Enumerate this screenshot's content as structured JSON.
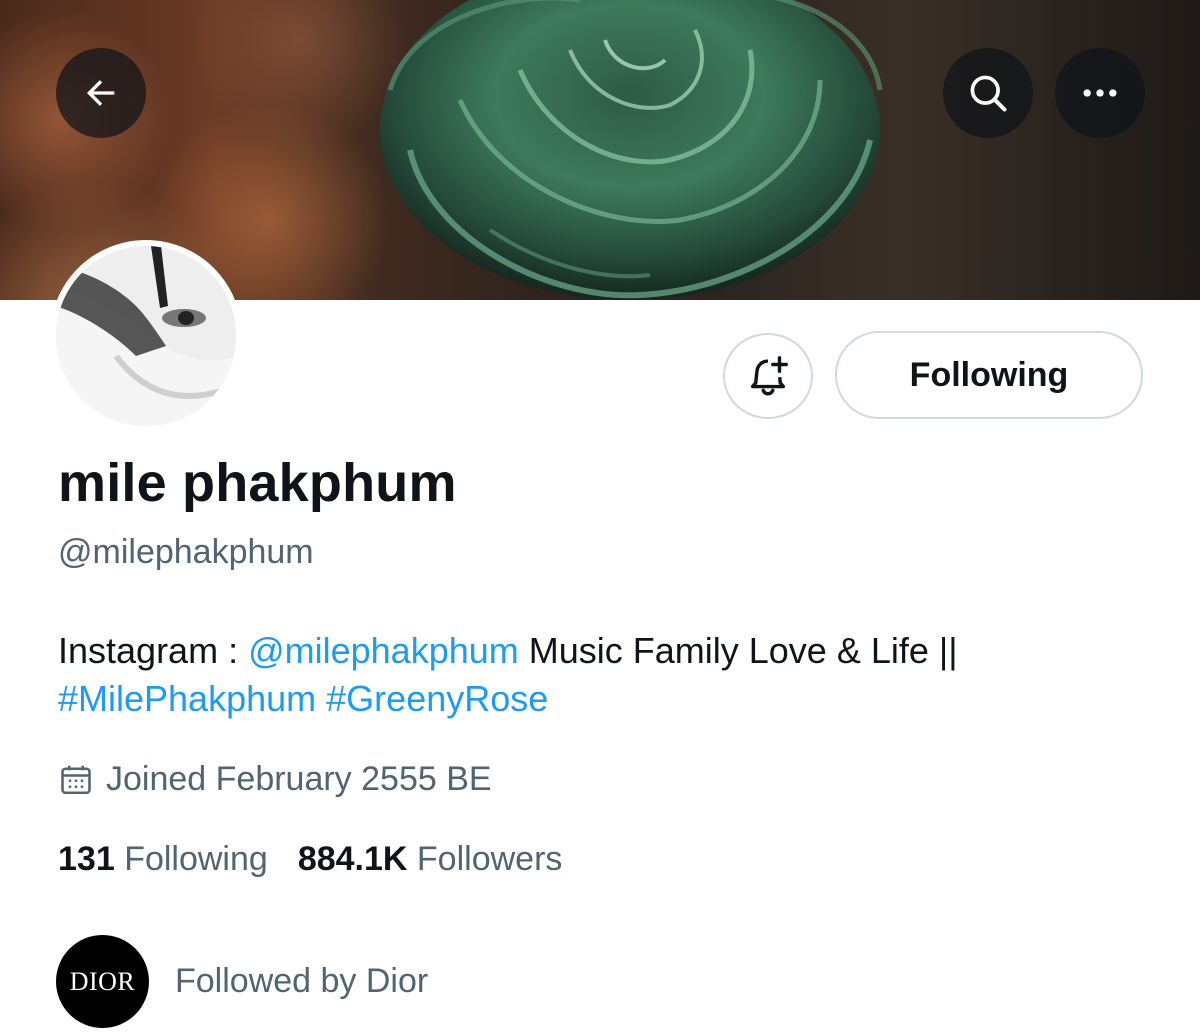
{
  "header": {
    "back_icon": "arrow-left-icon",
    "search_icon": "search-icon",
    "more_icon": "more-horizontal-icon"
  },
  "profile": {
    "display_name": "mile phakphum",
    "handle": "@milephakphum",
    "bio": {
      "prefix": "Instagram : ",
      "mention": "@milephakphum",
      "middle": " Music Family Love & Life ||",
      "hashtag1": "#MilePhakphum",
      "space": " ",
      "hashtag2": "#GreenyRose"
    },
    "joined": "Joined February 2555 BE",
    "following_count": "131",
    "following_label": "Following",
    "followers_count": "884.1K",
    "followers_label": "Followers"
  },
  "actions": {
    "notify_icon": "bell-plus-icon",
    "follow_label": "Following"
  },
  "followed_by": {
    "logo_text": "DIOR",
    "text": "Followed by Dior"
  },
  "colors": {
    "link": "#1d9bf0",
    "secondary_text": "#536471",
    "primary_text": "#0f1419",
    "border": "#cfd9de"
  }
}
